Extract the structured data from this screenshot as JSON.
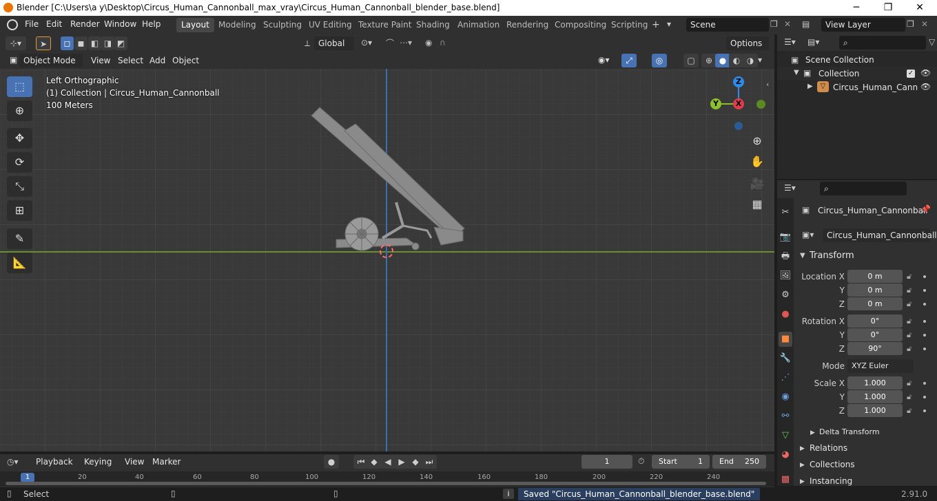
{
  "titlebar": {
    "title": "Blender [C:\\Users\\a y\\Desktop\\Circus_Human_Cannonball_max_vray\\Circus_Human_Cannonball_blender_base.blend]",
    "minimize": "─",
    "maximize": "❐",
    "close": "✕"
  },
  "menus": [
    "File",
    "Edit",
    "Render",
    "Window",
    "Help"
  ],
  "workspaces": [
    "Layout",
    "Modeling",
    "Sculpting",
    "UV Editing",
    "Texture Paint",
    "Shading",
    "Animation",
    "Rendering",
    "Compositing",
    "Scripting"
  ],
  "scene": {
    "name": "Scene",
    "view_layer": "View Layer",
    "add": "+"
  },
  "toolheader": {
    "transform_orientation": "Global",
    "options": "Options"
  },
  "viewport_header": {
    "mode": "Object Mode",
    "menus": [
      "View",
      "Select",
      "Add",
      "Object"
    ]
  },
  "overlay": {
    "view_name": "Left Orthographic",
    "collection_info": "(1) Collection | Circus_Human_Cannonball",
    "scale": "100 Meters"
  },
  "gizmo": {
    "z": "Z",
    "y": "Y",
    "x": "X"
  },
  "outliner": {
    "root": "Scene Collection",
    "collection": "Collection",
    "object": "Circus_Human_Cann"
  },
  "properties": {
    "object_name": "Circus_Human_Cannonball",
    "datablock": "Circus_Human_Cannonball",
    "transform_header": "Transform",
    "location_label": "Location X",
    "loc_x": "0 m",
    "y_label": "Y",
    "loc_y": "0 m",
    "z_label": "Z",
    "loc_z": "0 m",
    "rotation_label": "Rotation X",
    "rot_x": "0°",
    "rot_y": "0°",
    "rot_z": "90°",
    "mode_label": "Mode",
    "mode_value": "XYZ Euler",
    "scale_label": "Scale X",
    "scale_x": "1.000",
    "scale_y": "1.000",
    "scale_z": "1.000",
    "delta_transform": "Delta Transform",
    "sections": [
      "Relations",
      "Collections",
      "Instancing"
    ]
  },
  "timeline": {
    "menus": [
      "Playback",
      "Keying",
      "View",
      "Marker"
    ],
    "current_frame": "1",
    "start_label": "Start",
    "start": "1",
    "end_label": "End",
    "end": "250",
    "ticks": [
      "1",
      "20",
      "40",
      "60",
      "80",
      "100",
      "120",
      "140",
      "160",
      "180",
      "200",
      "220",
      "240"
    ]
  },
  "statusbar": {
    "select": "Select",
    "message": "Saved \"Circus_Human_Cannonball_blender_base.blend\"",
    "version": "2.91.0"
  },
  "colors": {
    "accent": "#4772b3",
    "x_axis": "#e13c4b",
    "y_axis": "#8bc128",
    "z_axis": "#2d8ceb",
    "orange": "#ff8a3c"
  }
}
